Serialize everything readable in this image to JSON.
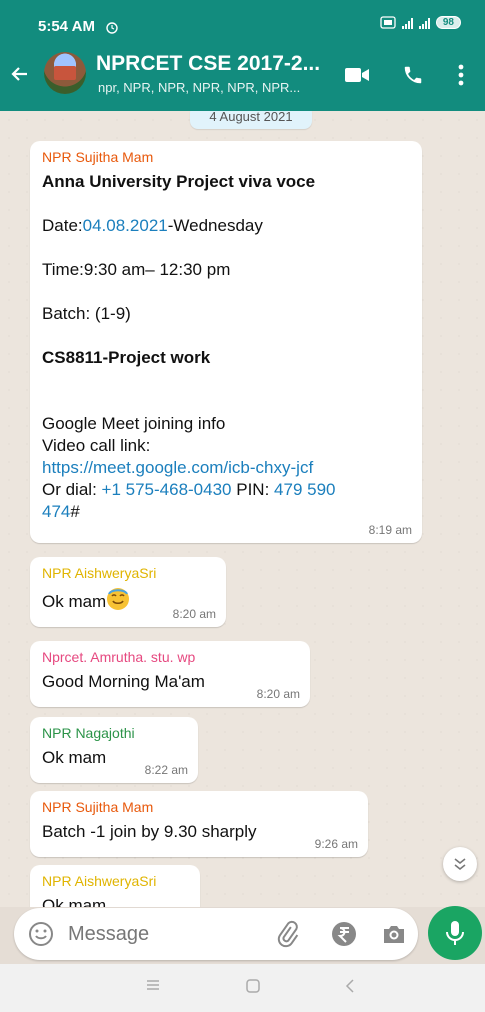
{
  "status_bar": {
    "time": "5:54 AM",
    "battery": "98"
  },
  "header": {
    "title": "NPRCET CSE 2017-2...",
    "subtitle": "npr, NPR, NPR, NPR, NPR, NPR..."
  },
  "date_chip": "4 August 2021",
  "messages": [
    {
      "sender": "NPR Sujitha Mam",
      "sender_color": "#e8590c",
      "lines": {
        "heading": "Anna University Project viva voce",
        "date_prefix": "Date:",
        "date_link": "04.08.2021",
        "date_suffix": "-Wednesday",
        "time_line": "Time:9:30 am– 12:30 pm",
        "batch_line": "Batch: (1-9)",
        "course": "CS8811-Project work",
        "meet_info": "Google Meet joining info",
        "video_label": "Video call link:",
        "meet_link": "https://meet.google.com/icb-chxy-jcf",
        "dial_prefix": "Or dial: ",
        "dial_number": "+1 575-468-0430",
        "pin_prefix": " PIN: ",
        "pin_part1": "479 590",
        "pin_part2": "474",
        "pin_suffix": "#"
      },
      "time": "8:19 am"
    },
    {
      "sender": "NPR AishweryaSri",
      "sender_color": "#e0b400",
      "text": "Ok mam",
      "time": "8:20 am"
    },
    {
      "sender": "Nprcet. Amrutha. stu. wp",
      "sender_color": "#e64980",
      "text": "Good Morning Ma'am",
      "time": "8:20 am"
    },
    {
      "sender": "NPR Nagajothi",
      "sender_color": "#2b9348",
      "text": "Ok mam",
      "time": "8:22 am"
    },
    {
      "sender": "NPR Sujitha Mam",
      "sender_color": "#e8590c",
      "text": "Batch -1 join by 9.30 sharply",
      "time": "9:26 am"
    },
    {
      "sender": "NPR AishweryaSri",
      "sender_color": "#e0b400",
      "text": "Ok mam"
    }
  ],
  "input": {
    "placeholder": "Message"
  },
  "colors": {
    "header": "#128c7e",
    "mic": "#1aa563",
    "link": "#1b7fbd"
  }
}
